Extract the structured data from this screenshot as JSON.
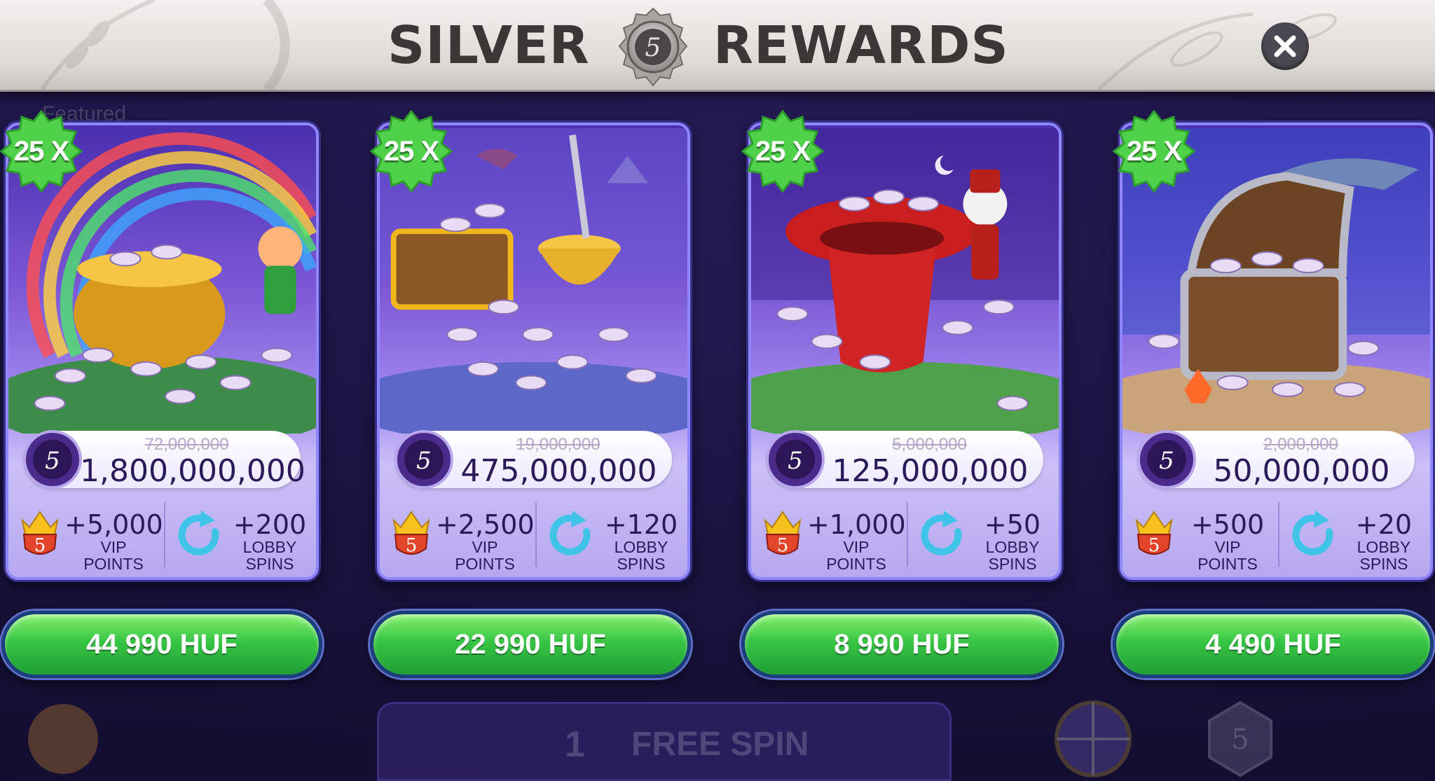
{
  "header": {
    "title_left": "SILVER",
    "title_right": "REWARDS",
    "tier_number": "5"
  },
  "background": {
    "featured_label": "Featured",
    "free_spin_count": "1",
    "free_spin_label": "FREE SPIN"
  },
  "colors": {
    "button_green": "#37c544",
    "card_purple": "#7a56d4",
    "badge_green": "#4fd14a",
    "text_dark": "#2b1a59"
  },
  "offers": [
    {
      "theme": "pot-of-gold",
      "multiplier": "25 X",
      "old_coins": "72,000,000",
      "coins": "1,800,000,000",
      "vip_points": "+5,000",
      "vip_label": "VIP\nPOINTS",
      "lobby_spins": "+200",
      "lobby_label": "LOBBY\nSPINS",
      "price": "44 990 HUF"
    },
    {
      "theme": "treasure-dragon",
      "multiplier": "25 X",
      "old_coins": "19,000,000",
      "coins": "475,000,000",
      "vip_points": "+2,500",
      "vip_label": "VIP\nPOINTS",
      "lobby_spins": "+120",
      "lobby_label": "LOBBY\nSPINS",
      "price": "22 990 HUF"
    },
    {
      "theme": "magic-hat",
      "multiplier": "25 X",
      "old_coins": "5,000,000",
      "coins": "125,000,000",
      "vip_points": "+1,000",
      "vip_label": "VIP\nPOINTS",
      "lobby_spins": "+50",
      "lobby_label": "LOBBY\nSPINS",
      "price": "8 990 HUF"
    },
    {
      "theme": "ocean-chest",
      "multiplier": "25 X",
      "old_coins": "2,000,000",
      "coins": "50,000,000",
      "vip_points": "+500",
      "vip_label": "VIP\nPOINTS",
      "lobby_spins": "+20",
      "lobby_label": "LOBBY\nSPINS",
      "price": "4 490 HUF"
    }
  ]
}
